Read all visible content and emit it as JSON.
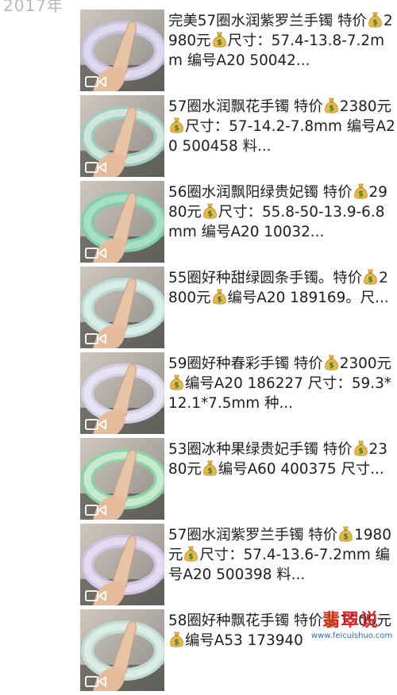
{
  "year_label": "2017年",
  "posts": [
    {
      "text_before": "完美57圈水润紫罗兰手镯 特价",
      "price": "2980元",
      "text_after": "尺寸：57.4-13.8-7.2mm 编号A20 50042...",
      "jade_color": "#ddd8ec",
      "band_color": "#c9c2e0"
    },
    {
      "text_before": "57圈水润飘花手镯 特价",
      "price": "2380元",
      "text_after": "尺寸：57-14.2-7.8mm 编号A20 500458 料...",
      "jade_color": "#cfe6de",
      "band_color": "#9fcfc0"
    },
    {
      "text_before": "56圈水润飘阳绿贵妃镯 特价",
      "price": "2980元",
      "text_after": "尺寸：55.8-50-13.9-6.8mm 编号A20 10032...",
      "jade_color": "#a8dec5",
      "band_color": "#7fcfae"
    },
    {
      "text_before": "55圈好种甜绿圆条手镯。特价",
      "price": "2800元",
      "text_after": "编号A20 189169。尺...",
      "jade_color": "#d8ece8",
      "band_color": "#b9dcd4"
    },
    {
      "text_before": "59圈好种春彩手镯 特价",
      "price": "2300元",
      "text_after": "编号A20 186227 尺寸：59.3*12.1*7.5mm 种...",
      "jade_color": "#e7e4f1",
      "band_color": "#d3cfe6"
    },
    {
      "text_before": "53圈冰种果绿贵妃手镯 特价",
      "price": "2380元",
      "text_after": "编号A60 400375 尺寸...",
      "jade_color": "#c6ead0",
      "band_color": "#8ed3a2"
    },
    {
      "text_before": "57圈水润紫罗兰手镯 特价",
      "price": "1980元",
      "text_after": "尺寸：57.4-13.6-7.2mm 编号A20 500398 料...",
      "jade_color": "#e3dcef",
      "band_color": "#cfc3e6"
    },
    {
      "text_before": "58圈好种飘花手镯 特价",
      "price": "1500元",
      "text_after": "编号A53 173940",
      "jade_color": "#dcebe4",
      "band_color": "#bfdcd0"
    }
  ],
  "watermark": {
    "title": "翡翠说",
    "url": "www.feicuishuo.com"
  },
  "colors": {
    "bag_gold": "#e6b84a",
    "bag_dark": "#b98a22",
    "dollar_green": "#3e7f2f",
    "watermark_red": "#d8262b",
    "watermark_blue": "#2a6ec9"
  }
}
